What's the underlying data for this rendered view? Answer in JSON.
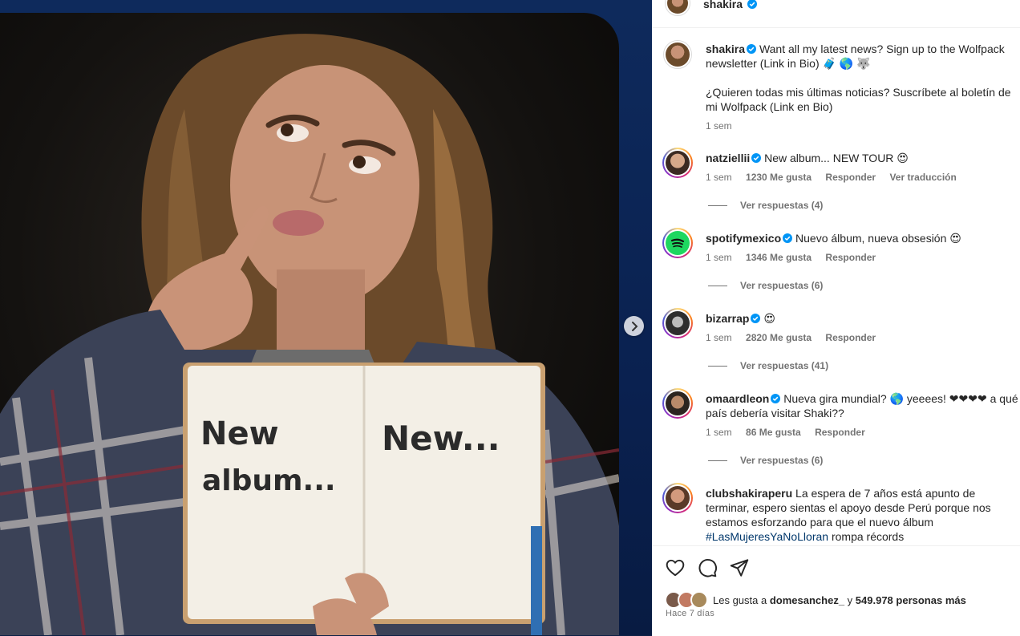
{
  "header": {
    "username": "shakira"
  },
  "caption": {
    "username": "shakira",
    "text_en": "Want all my latest news? Sign up to the Wolfpack newsletter (Link in Bio) 🧳 🌎 🐺",
    "text_es": "¿Quieren todas mis últimas noticias? Suscríbete al boletín de mi Wolfpack (Link en Bio)",
    "time": "1 sem"
  },
  "comments": [
    {
      "username": "natziellii",
      "text": "New album... NEW TOUR 😍",
      "time": "1 sem",
      "likes": "1230 Me gusta",
      "reply": "Responder",
      "translate": "Ver traducción",
      "view_replies": "Ver respuestas (4)",
      "avatar_color": "#c98b6a"
    },
    {
      "username": "spotifymexico",
      "text": "Nuevo álbum, nueva obsesión 😍",
      "time": "1 sem",
      "likes": "1346 Me gusta",
      "reply": "Responder",
      "view_replies": "Ver respuestas (6)",
      "avatar_color": "#1ed760"
    },
    {
      "username": "bizarrap",
      "text": "😍",
      "time": "1 sem",
      "likes": "2820 Me gusta",
      "reply": "Responder",
      "view_replies": "Ver respuestas (41)",
      "avatar_color": "#3a3a3a"
    },
    {
      "username": "omaardleon",
      "text": "Nueva gira mundial? 🌎 yeeees! ❤❤❤❤ a qué país debería visitar Shaki??",
      "time": "1 sem",
      "likes": "86 Me gusta",
      "reply": "Responder",
      "view_replies": "Ver respuestas (6)",
      "avatar_color": "#8a6a4e"
    },
    {
      "username": "clubshakiraperu",
      "text": "La espera de 7 años está apunto de terminar, espero sientas el apoyo desde Perú porque nos estamos esforzando para que el nuevo álbum",
      "hashtag": "#LasMujeresYaNoLloran",
      "text_tail": "rompa récords",
      "avatar_color": "#d39a7d"
    }
  ],
  "footer": {
    "likes_prefix": "Les gusta a",
    "liked_by": "domesanchez_",
    "likes_middle": "y",
    "likes_count": "549.978 personas más",
    "time_ago": "Hace 7 días"
  },
  "notebook": {
    "left_line1": "New",
    "left_line2": "album...",
    "right_line1": "New..."
  },
  "colors": {
    "background": "#0b1f45",
    "verified": "#0095f6",
    "link": "#00376b",
    "muted": "#737373"
  },
  "icons": [
    "verified-icon",
    "heart-icon",
    "comment-icon",
    "share-icon",
    "chevron-right-icon"
  ]
}
